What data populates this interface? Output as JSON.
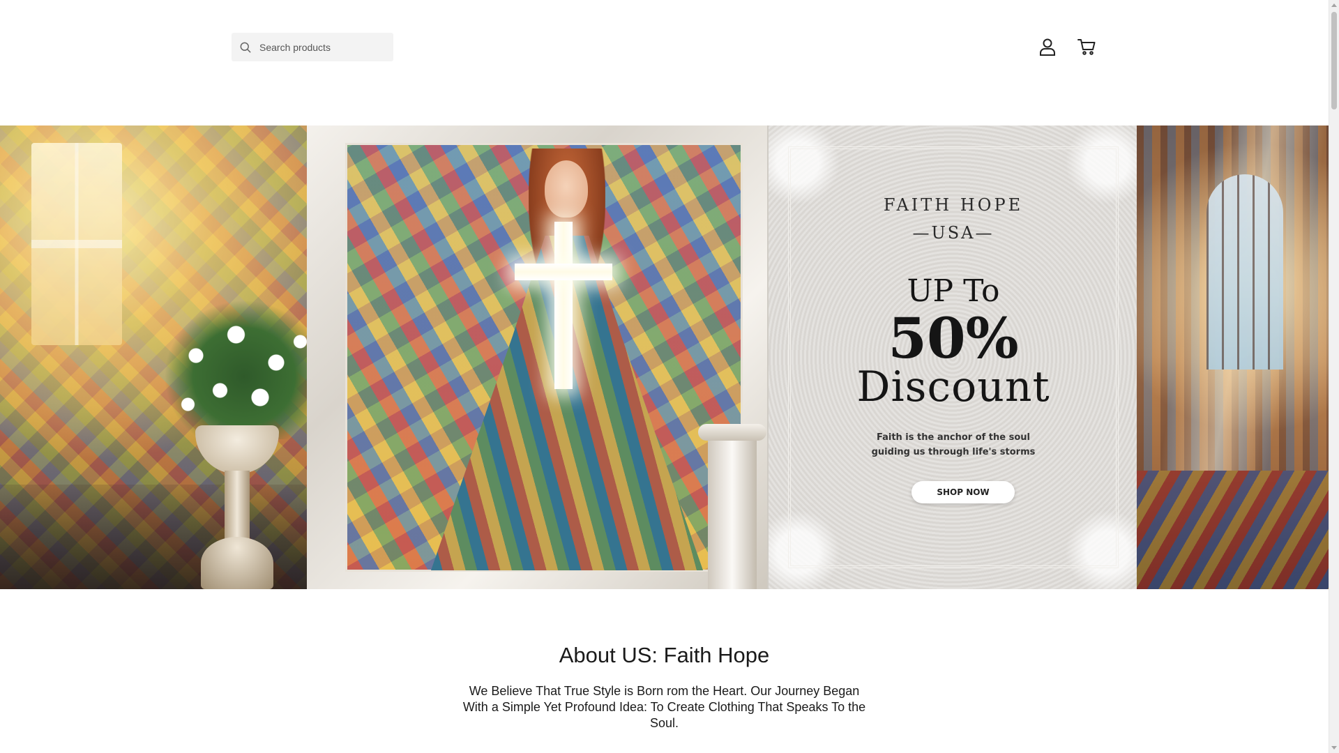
{
  "header": {
    "search": {
      "placeholder": "Search products",
      "value": "",
      "icon": "search-icon"
    },
    "account_icon": "user-icon",
    "cart_icon": "cart-icon"
  },
  "hero": {
    "brand": "FAITH HOPE",
    "country": "—USA—",
    "offer_prefix": "UP To",
    "offer_percent": "50%",
    "offer_suffix": "Discount",
    "tagline_line1": "Faith is the anchor of the soul",
    "tagline_line2": "guiding us through life's storms",
    "cta_label": "SHOP NOW"
  },
  "about": {
    "title": "About US: Faith Hope",
    "body": "We Believe That True Style is Born rom the Heart. Our Journey Began With a Simple Yet Profound Idea: To Create Clothing That Speaks To the Soul."
  },
  "colors": {
    "background": "#ffffff",
    "search_background": "#f3f3f3",
    "text": "#1a1a1a"
  }
}
